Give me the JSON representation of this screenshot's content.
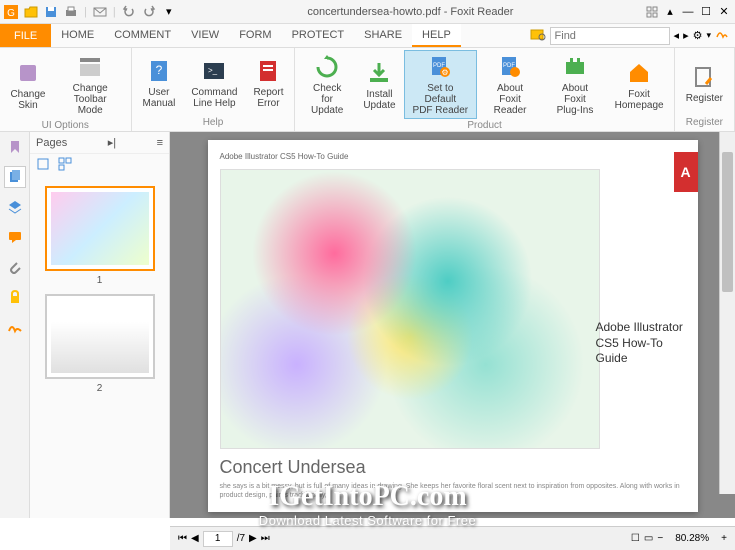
{
  "window": {
    "title": "concertundersea-howto.pdf - Foxit Reader"
  },
  "qat_icons": [
    "logo",
    "open",
    "save",
    "print",
    "email",
    "undo",
    "redo"
  ],
  "menu": {
    "file": "FILE",
    "tabs": [
      "HOME",
      "COMMENT",
      "VIEW",
      "FORM",
      "PROTECT",
      "SHARE",
      "HELP"
    ],
    "active": "HELP"
  },
  "search": {
    "placeholder": "Find"
  },
  "ribbon": {
    "groups": [
      {
        "label": "UI Options",
        "items": [
          {
            "label": "Change\nSkin",
            "icon": "skin"
          },
          {
            "label": "Change\nToolbar Mode",
            "icon": "toolbar"
          }
        ]
      },
      {
        "label": "Help",
        "items": [
          {
            "label": "User\nManual",
            "icon": "manual"
          },
          {
            "label": "Command\nLine Help",
            "icon": "cmd"
          },
          {
            "label": "Report\nError",
            "icon": "report"
          }
        ]
      },
      {
        "label": "Product",
        "items": [
          {
            "label": "Check for\nUpdate",
            "icon": "update"
          },
          {
            "label": "Install\nUpdate",
            "icon": "install"
          },
          {
            "label": "Set to Default\nPDF Reader",
            "icon": "default",
            "active": true
          },
          {
            "label": "About Foxit\nReader",
            "icon": "about"
          },
          {
            "label": "About Foxit\nPlug-Ins",
            "icon": "plugins"
          },
          {
            "label": "Foxit\nHomepage",
            "icon": "home"
          }
        ]
      },
      {
        "label": "Register",
        "items": [
          {
            "label": "Register",
            "icon": "register"
          }
        ]
      }
    ]
  },
  "sidebar": {
    "pages_label": "Pages",
    "tabs": [
      "bookmark",
      "pages",
      "layers",
      "comments",
      "attachments",
      "security",
      "signatures"
    ]
  },
  "thumbnails": [
    {
      "num": "1",
      "active": true
    },
    {
      "num": "2",
      "active": false
    }
  ],
  "document": {
    "header": "Adobe Illustrator CS5 How-To Guide",
    "side_title": "Adobe Illustrator CS5 How-To Guide",
    "body_title": "Concert Undersea",
    "body_text": "she says is a bit messy, but is full of many ideas in drawing. She keeps her favorite floral scent next to inspiration from opposites. Along with works in product design, paints traditionally,"
  },
  "statusbar": {
    "page_current": "1",
    "page_total": "/7",
    "zoom": "80.28%"
  },
  "watermark": {
    "main": "IGetIntoPC.com",
    "sub": "Download Latest Software for Free"
  },
  "colors": {
    "accent": "#ff8c00",
    "active_tab": "#cce8f5"
  }
}
